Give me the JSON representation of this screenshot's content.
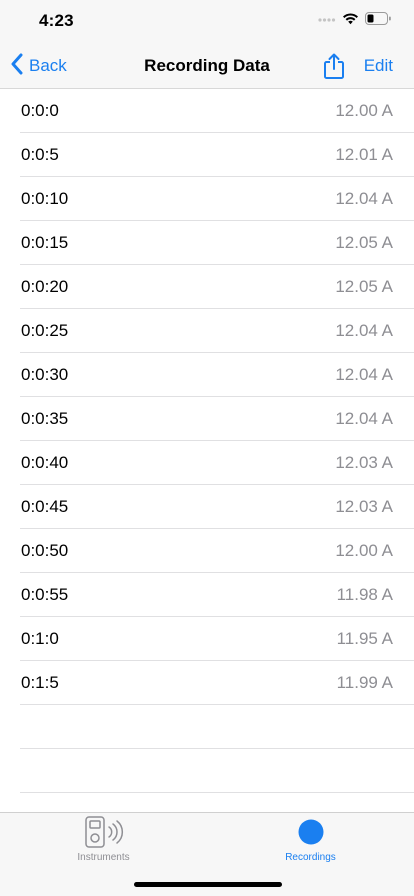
{
  "status_bar": {
    "time": "4:23"
  },
  "nav": {
    "back_label": "Back",
    "title": "Recording Data",
    "edit_label": "Edit"
  },
  "rows": [
    {
      "time": "0:0:0",
      "value": "12.00 A"
    },
    {
      "time": "0:0:5",
      "value": "12.01 A"
    },
    {
      "time": "0:0:10",
      "value": "12.04 A"
    },
    {
      "time": "0:0:15",
      "value": "12.05 A"
    },
    {
      "time": "0:0:20",
      "value": "12.05 A"
    },
    {
      "time": "0:0:25",
      "value": "12.04 A"
    },
    {
      "time": "0:0:30",
      "value": "12.04 A"
    },
    {
      "time": "0:0:35",
      "value": "12.04 A"
    },
    {
      "time": "0:0:40",
      "value": "12.03 A"
    },
    {
      "time": "0:0:45",
      "value": "12.03 A"
    },
    {
      "time": "0:0:50",
      "value": "12.00 A"
    },
    {
      "time": "0:0:55",
      "value": "11.98 A"
    },
    {
      "time": "0:1:0",
      "value": "11.95 A"
    },
    {
      "time": "0:1:5",
      "value": "11.99 A"
    }
  ],
  "tabs": [
    {
      "label": "Instruments",
      "icon": "instrument-icon",
      "selected": false
    },
    {
      "label": "Recordings",
      "icon": "record-circle-icon",
      "selected": true
    }
  ],
  "colors": {
    "accent": "#1a7ff0",
    "secondary_text": "#8e8e93",
    "bar_background": "#f7f7f7"
  }
}
